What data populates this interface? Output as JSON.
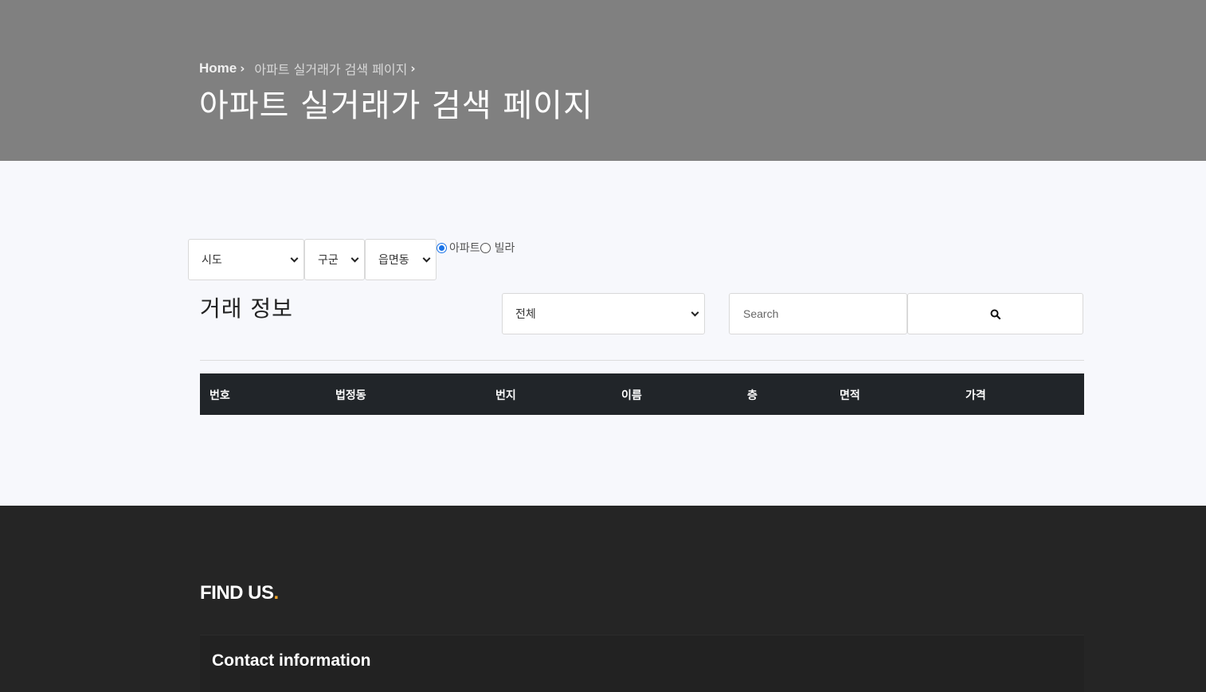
{
  "hero": {
    "breadcrumb_home": "Home",
    "breadcrumb_current": "아파트 실거래가 검색 페이지",
    "title": "아파트 실거래가 검색 페이지"
  },
  "filters": {
    "sido": "시도",
    "gugun": "구군",
    "dong": "읍면동",
    "radio_apartment": "아파트",
    "radio_villa": "빌라",
    "selected_type": "아파트"
  },
  "transactions": {
    "title": "거래 정보",
    "category_select": "전체",
    "search_placeholder": "Search",
    "columns": [
      "번호",
      "법정동",
      "번지",
      "이름",
      "층",
      "면적",
      "가격"
    ]
  },
  "footer": {
    "find_us": "FIND US",
    "find_us_dot": ".",
    "contact_title": "Contact information"
  },
  "colors": {
    "hero_bg": "#808080",
    "table_head_bg": "#212529",
    "footer_bg": "#252525",
    "accent": "#f4a62a",
    "radio_checked": "#1a73e8"
  },
  "icons": {
    "search": "search-icon",
    "breadcrumb_separator": "chevron-right-icon",
    "select_dropdown": "chevron-down-icon"
  }
}
